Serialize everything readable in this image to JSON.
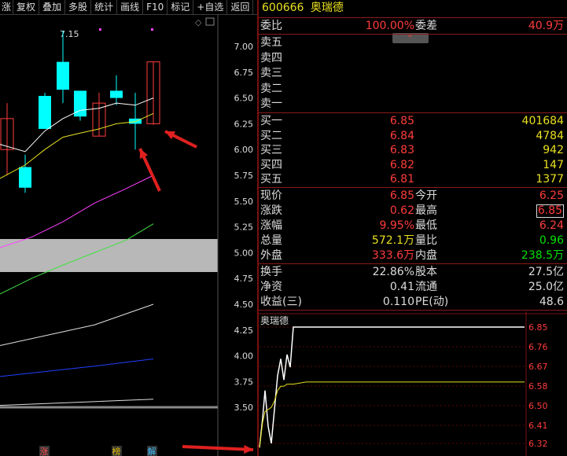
{
  "toolbar": {
    "items": [
      "涨",
      "复权",
      "叠加",
      "多股",
      "统计",
      "画线",
      "F10",
      "标记",
      "+自选",
      "返回"
    ]
  },
  "kline": {
    "price_ticks": [
      "7.00",
      "6.75",
      "6.50",
      "6.25",
      "6.00",
      "5.75",
      "5.50",
      "5.25",
      "5.00",
      "4.75",
      "4.50",
      "4.25",
      "4.00",
      "3.75",
      "3.50"
    ],
    "high_label": "7.15",
    "bottom_marks": [
      "涨",
      "榜",
      "解"
    ],
    "colors": {
      "up": "#ff3c3c",
      "down": "#00ffff",
      "ma5": "#ffffff",
      "ma10": "#e8e020",
      "ma20": "#ff40ff",
      "ma30": "#40e040",
      "ma60": "#e0e0e0",
      "ma120": "#2040ff"
    }
  },
  "quote": {
    "code": "600666",
    "name": "奥瑞德",
    "weibi_label": "委比",
    "weibi_value": "100.00%",
    "weicha_label": "委差",
    "weicha_value": "40.9万",
    "sell": [
      {
        "label": "卖五",
        "price": "",
        "vol": ""
      },
      {
        "label": "卖四",
        "price": "",
        "vol": ""
      },
      {
        "label": "卖三",
        "price": "",
        "vol": ""
      },
      {
        "label": "卖二",
        "price": "",
        "vol": ""
      },
      {
        "label": "卖一",
        "price": "",
        "vol": ""
      }
    ],
    "buy": [
      {
        "label": "买一",
        "price": "6.85",
        "vol": "401684"
      },
      {
        "label": "买二",
        "price": "6.84",
        "vol": "4784"
      },
      {
        "label": "买三",
        "price": "6.83",
        "vol": "942"
      },
      {
        "label": "买四",
        "price": "6.82",
        "vol": "147"
      },
      {
        "label": "买五",
        "price": "6.81",
        "vol": "1377"
      }
    ],
    "stats": [
      {
        "l1": "现价",
        "v1": "6.85",
        "c1": "red",
        "l2": "今开",
        "v2": "6.25",
        "c2": "red"
      },
      {
        "l1": "涨跌",
        "v1": "0.62",
        "c1": "red",
        "l2": "最高",
        "v2": "6.85",
        "c2": "red"
      },
      {
        "l1": "涨幅",
        "v1": "9.95%",
        "c1": "red",
        "l2": "最低",
        "v2": "6.24",
        "c2": "red"
      },
      {
        "l1": "总量",
        "v1": "572.1万",
        "c1": "yel",
        "l2": "量比",
        "v2": "0.96",
        "c2": "green"
      },
      {
        "l1": "外盘",
        "v1": "333.6万",
        "c1": "red",
        "l2": "内盘",
        "v2": "238.5万",
        "c2": "green"
      }
    ],
    "fundamentals": [
      {
        "l1": "换手",
        "v1": "22.86%",
        "l2": "股本",
        "v2": "27.5亿"
      },
      {
        "l1": "净资",
        "v1": "0.41",
        "l2": "流通",
        "v2": "25.0亿"
      },
      {
        "l1": "收益(三)",
        "v1": "0.110",
        "l2": "PE(动)",
        "v2": "48.6"
      }
    ]
  },
  "minichart": {
    "title": "奥瑞德",
    "ticks": [
      "6.85",
      "6.76",
      "6.67",
      "6.58",
      "6.50",
      "6.41",
      "6.32"
    ]
  },
  "chart_data": {
    "type": "line",
    "title": "奥瑞德",
    "ylim": [
      6.24,
      6.85
    ],
    "series": [
      {
        "values": [
          6.28,
          6.42,
          6.55,
          6.38,
          6.3,
          6.46,
          6.62,
          6.7,
          6.6,
          6.72,
          6.66,
          6.85,
          6.85,
          6.85,
          6.85,
          6.85,
          6.85,
          6.85,
          6.85,
          6.85,
          6.85
        ]
      },
      {
        "values": [
          6.28,
          6.4,
          6.45,
          6.46,
          6.47,
          6.5,
          6.55,
          6.57,
          6.57,
          6.58,
          6.58,
          6.58,
          6.59,
          6.59,
          6.59,
          6.59,
          6.59,
          6.59,
          6.59,
          6.59,
          6.59
        ]
      }
    ]
  }
}
